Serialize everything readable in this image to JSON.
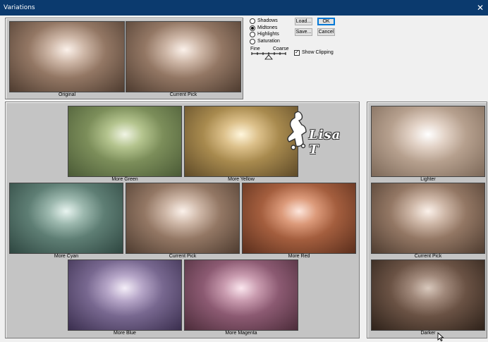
{
  "window": {
    "title": "Variations",
    "close_glyph": "✕"
  },
  "preview": {
    "original_label": "Original",
    "current_pick_label": "Current Pick"
  },
  "range": {
    "options": [
      "Shadows",
      "Midtones",
      "Highlights",
      "Saturation"
    ],
    "selected": "Midtones"
  },
  "slider": {
    "fine_label": "Fine",
    "coarse_label": "Coarse"
  },
  "buttons": {
    "load": "Load...",
    "save": "Save...",
    "ok": "OK",
    "cancel": "Cancel"
  },
  "show_clipping": {
    "label": "Show Clipping",
    "checked": true,
    "check_glyph": "✓"
  },
  "color_grid": {
    "more_green": "More Green",
    "more_yellow": "More Yellow",
    "more_cyan": "More Cyan",
    "current_pick": "Current Pick",
    "more_red": "More Red",
    "more_blue": "More Blue",
    "more_magenta": "More Magenta"
  },
  "brightness": {
    "lighter": "Lighter",
    "current_pick": "Current Pick",
    "darker": "Darker"
  },
  "watermark": {
    "text": "Lisa T"
  },
  "colors": {
    "titlebar": "#0b3a6e",
    "panel": "#c4c4c4",
    "dialog_bg": "#f0f0f0",
    "accent": "#0078d7"
  }
}
